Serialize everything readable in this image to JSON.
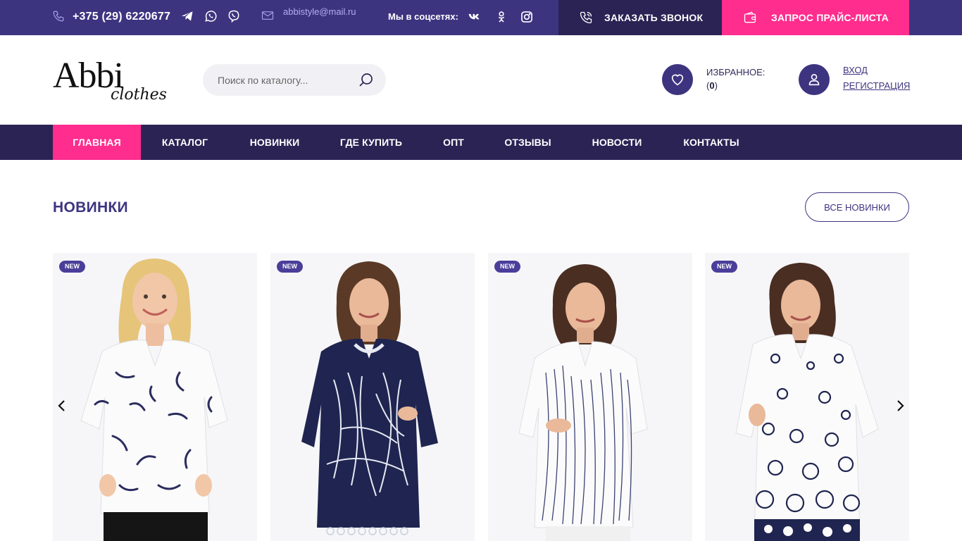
{
  "topbar": {
    "phone": "+375 (29) 6220677",
    "email": "abbistyle@mail.ru",
    "social_label": "Мы в соцсетях:",
    "call_label": "ЗАКАЗАТЬ ЗВОНОК",
    "price_label": "ЗАПРОС ПРАЙС-ЛИСТА",
    "icons": [
      "phone-icon",
      "telegram-icon",
      "whatsapp-icon",
      "viber-icon",
      "mail-icon",
      "vk-icon",
      "odnoklassniki-icon",
      "instagram-icon"
    ]
  },
  "header": {
    "logo_main": "Abbi",
    "logo_sub": "clothes",
    "search_placeholder": "Поиск по каталогу...",
    "favorites_label": "ИЗБРАННОЕ:",
    "favorites_open": "(",
    "favorites_count": "0",
    "favorites_close": ")",
    "login_label": "ВХОД",
    "register_label": "РЕГИСТРАЦИЯ"
  },
  "nav": {
    "items": [
      "ГЛАВНАЯ",
      "КАТАЛОГ",
      "НОВИНКИ",
      "ГДЕ КУПИТЬ",
      "ОПТ",
      "ОТЗЫВЫ",
      "НОВОСТИ",
      "КОНТАКТЫ"
    ],
    "active": "ГЛАВНАЯ"
  },
  "section": {
    "title": "НОВИНКИ",
    "all_button": "ВСЕ НОВИНКИ"
  },
  "products": [
    {
      "badge": "NEW"
    },
    {
      "badge": "NEW"
    },
    {
      "badge": "NEW"
    },
    {
      "badge": "NEW"
    }
  ],
  "colors": {
    "primary": "#3d3480",
    "dark": "#2a2354",
    "accent": "#ff2d8e"
  }
}
